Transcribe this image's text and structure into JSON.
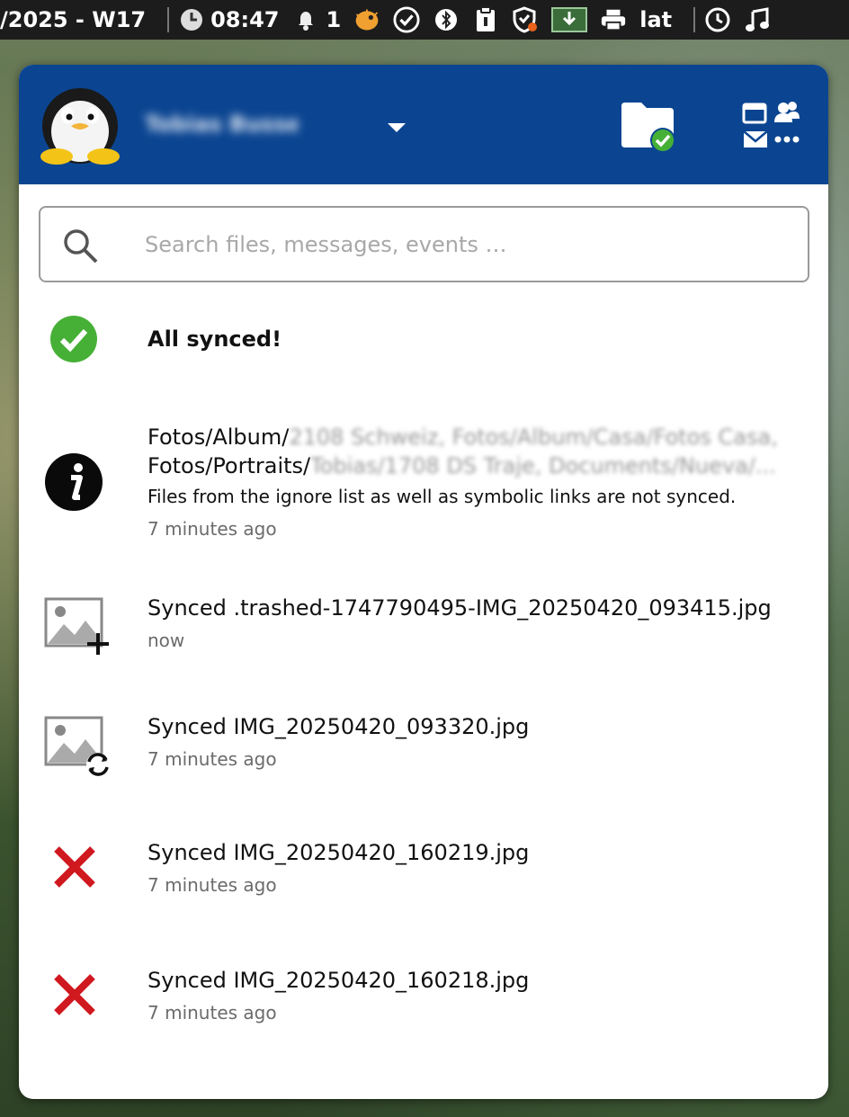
{
  "topbar": {
    "date_week": "/2025 - W17",
    "clock_time": "08:47",
    "notification_count": "1",
    "keyboard_layout": "lat"
  },
  "popup": {
    "header": {
      "username": "Tobias Busse",
      "accent_color": "#0b4591"
    },
    "search": {
      "placeholder": "Search files, messages, events …"
    },
    "status": {
      "label": "All synced!"
    },
    "activities": [
      {
        "icon": "info-icon",
        "line1_prefix": "Fotos/Album/",
        "line1_blurred": "2108 Schweiz, Fotos/Album/Casa/Fotos Casa,",
        "line2_prefix": "Fotos/Portraits/",
        "line2_blurred": "Tobias/1708 DS Traje, Documents/Nueva/...",
        "message": "Files from the ignore list as well as symbolic links are not synced.",
        "time": "7 minutes ago"
      },
      {
        "icon": "image-added-icon",
        "title": "Synced .trashed-1747790495-IMG_20250420_093415.jpg",
        "time": "now"
      },
      {
        "icon": "image-sync-icon",
        "title": "Synced IMG_20250420_093320.jpg",
        "time": "7 minutes ago"
      },
      {
        "icon": "error-x-icon",
        "title": "Synced IMG_20250420_160219.jpg",
        "time": "7 minutes ago"
      },
      {
        "icon": "error-x-icon",
        "title": "Synced IMG_20250420_160218.jpg",
        "time": "7 minutes ago"
      }
    ]
  }
}
